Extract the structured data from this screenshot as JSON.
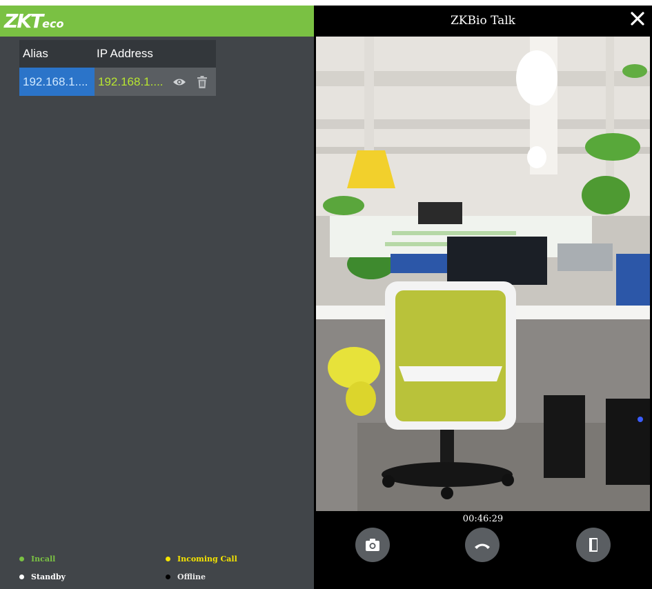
{
  "app": {
    "logo": {
      "main": "ZKT",
      "suffix": "eco"
    }
  },
  "device_table": {
    "headers": {
      "alias": "Alias",
      "ip": "IP Address"
    },
    "rows": [
      {
        "alias": "192.168.1....",
        "ip": "192.168.1....",
        "actions": [
          "eye-icon",
          "trash-icon"
        ]
      }
    ]
  },
  "legend": [
    {
      "label": "Incall",
      "color": "#7ac143"
    },
    {
      "label": "Incoming Call",
      "color": "#f5e400"
    },
    {
      "label": "Standby",
      "color": "#ffffff"
    },
    {
      "label": "Offline",
      "color": "#000000"
    }
  ],
  "talk": {
    "title": "ZKBio Talk",
    "timer": "00:46:29",
    "buttons": [
      "camera-icon",
      "hang-up-icon",
      "door-icon"
    ]
  }
}
